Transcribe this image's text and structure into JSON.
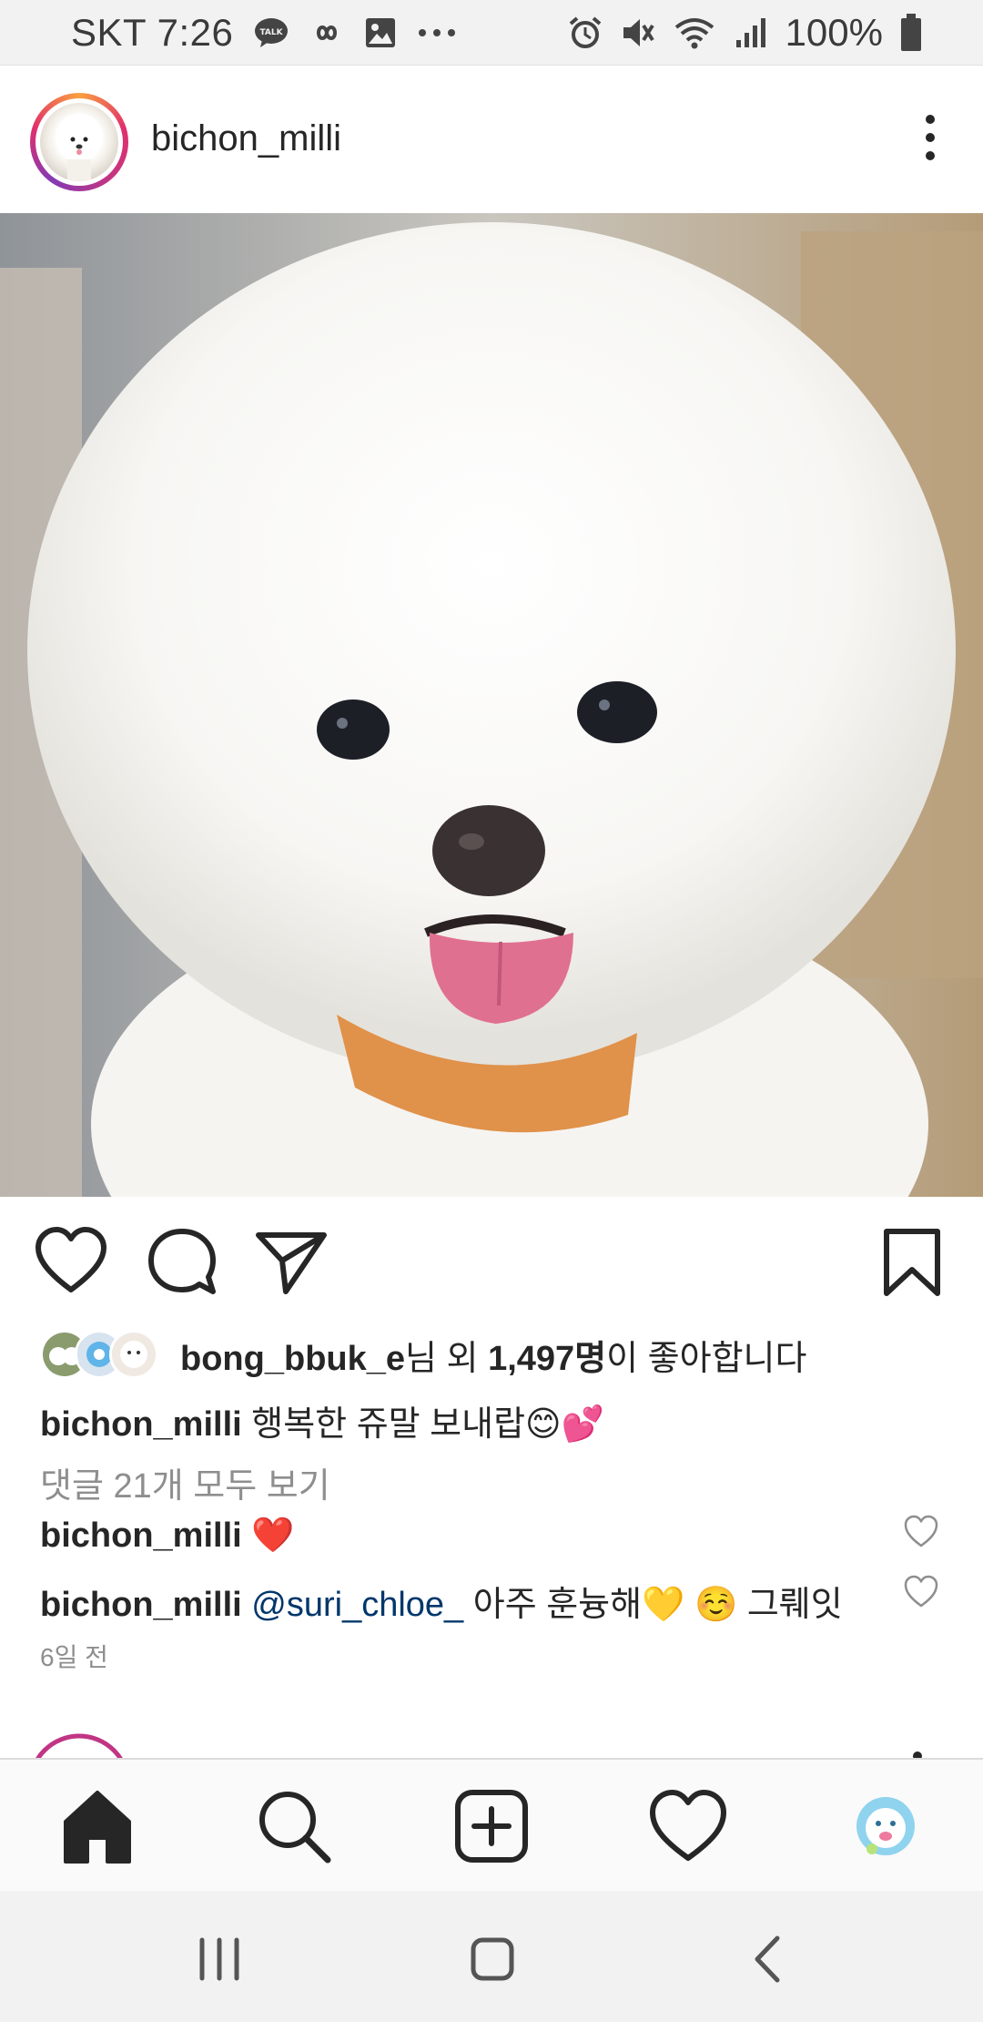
{
  "status_bar": {
    "carrier_time": "SKT 7:26",
    "battery_percent": "100%",
    "icons": [
      "kakaotalk-icon",
      "infinity-icon",
      "gallery-icon",
      "more-notifications-icon",
      "alarm-icon",
      "mute-icon",
      "wifi-icon",
      "signal-icon",
      "battery-icon"
    ]
  },
  "post": {
    "username": "bichon_milli",
    "image_subject": "white bichon frise dog",
    "likes": {
      "user": "bong_bbuk_e",
      "suffix_1": "님 외 ",
      "count": "1,497명",
      "suffix_2": "이 좋아합니다"
    },
    "caption": {
      "username": "bichon_milli",
      "text": "행복한 쥬말 보내랍😊💕"
    },
    "view_comments": "댓글 21개 모두 보기",
    "comments": [
      {
        "username": "bichon_milli",
        "mention": "",
        "text": "❤️"
      },
      {
        "username": "bichon_milli",
        "mention": "@suri_chloe_",
        "text": " 아주 훈늉해💛 ☺️ 그뤠잇"
      }
    ],
    "timestamp": "6일 전"
  },
  "bottom_nav": {
    "items": [
      "home-icon",
      "search-icon",
      "new-post-icon",
      "activity-heart-icon",
      "profile-avatar"
    ],
    "active": "home-icon"
  },
  "system_nav": {
    "items": [
      "recent-apps-button",
      "home-button",
      "back-button"
    ]
  },
  "colors": {
    "text": "#262626",
    "secondary": "#8e8e8e",
    "mention": "#00376b",
    "status_bar_bg": "#f2f2f2",
    "heart_red": "#ed4956"
  }
}
